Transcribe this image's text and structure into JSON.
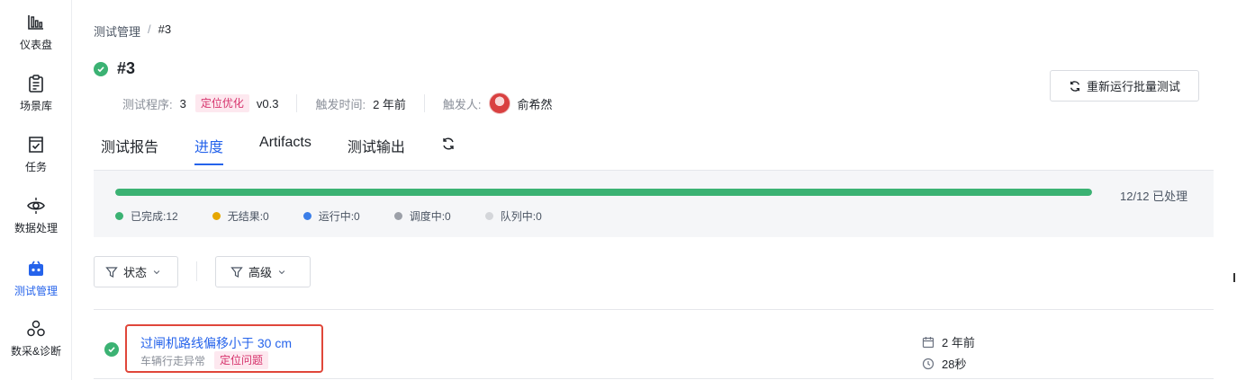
{
  "sidebar": {
    "items": [
      {
        "label": "仪表盘",
        "icon": "bar-chart-icon",
        "active": false
      },
      {
        "label": "场景库",
        "icon": "clipboard-icon",
        "active": false
      },
      {
        "label": "任务",
        "icon": "task-check-icon",
        "active": false
      },
      {
        "label": "数据处理",
        "icon": "data-eye-icon",
        "active": false
      },
      {
        "label": "测试管理",
        "icon": "test-case-icon",
        "active": true
      },
      {
        "label": "数采&诊断",
        "icon": "collect-diagnose-icon",
        "active": false
      }
    ]
  },
  "breadcrumb": {
    "parent": "测试管理",
    "separator": "/",
    "current": "#3"
  },
  "header": {
    "title": "#3",
    "status": "success",
    "program_label": "测试程序:",
    "program_value": "3",
    "program_tag": "定位优化",
    "program_version": "v0.3",
    "trigger_time_label": "触发时间:",
    "trigger_time_value": "2 年前",
    "trigger_user_label": "触发人:",
    "trigger_user_value": "俞希然",
    "rerun_button": "重新运行批量测试"
  },
  "tabs": [
    {
      "label": "测试报告",
      "active": false
    },
    {
      "label": "进度",
      "active": true
    },
    {
      "label": "Artifacts",
      "active": false
    },
    {
      "label": "测试输出",
      "active": false
    }
  ],
  "progress": {
    "fraction": 1.0,
    "text": "12/12 已处理",
    "legend": [
      {
        "label": "已完成:12",
        "color": "#3bb273"
      },
      {
        "label": "无结果:0",
        "color": "#e6a700"
      },
      {
        "label": "运行中:0",
        "color": "#3b7ee8"
      },
      {
        "label": "调度中:0",
        "color": "#9ca0a8"
      },
      {
        "label": "队列中:0",
        "color": "#d4d6da"
      }
    ]
  },
  "filters": {
    "status_label": "状态",
    "advanced_label": "高级"
  },
  "cases": [
    {
      "title": "过闸机路线偏移小于 30 cm",
      "subtitle": "车辆行走异常",
      "tag": "定位问题",
      "time": "2 年前",
      "duration": "28秒",
      "status": "success"
    }
  ],
  "colors": {
    "accent": "#2563eb",
    "success": "#3bb273",
    "tag_bg": "#fde8ef",
    "tag_fg": "#d6336c",
    "highlight_box": "#e0473a"
  }
}
